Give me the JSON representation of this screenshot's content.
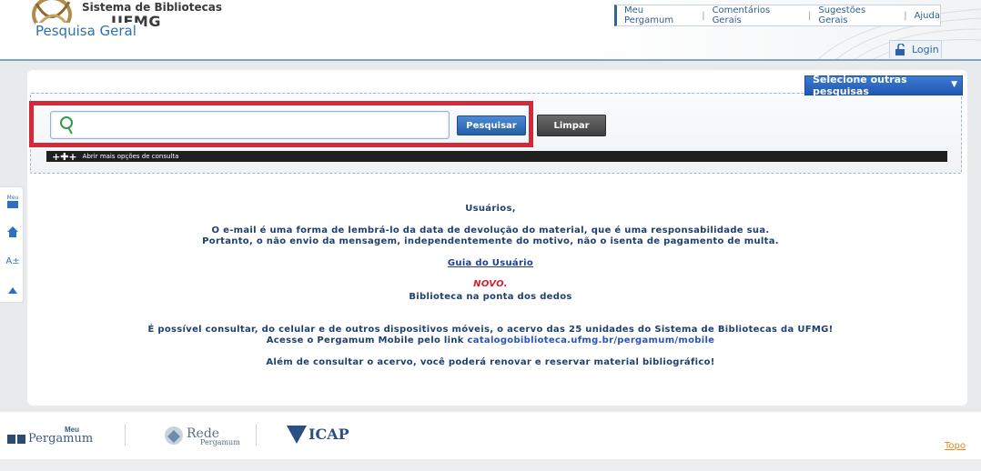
{
  "header": {
    "logo_title": "Sistema de Bibliotecas",
    "logo_subtitle": "UFMG",
    "nav": [
      {
        "label": "Meu Pergamum"
      },
      {
        "label": "Comentários Gerais"
      },
      {
        "label": "Sugestões Gerais"
      },
      {
        "label": "Ajuda"
      }
    ],
    "login_label": "Login"
  },
  "search": {
    "legend": "Pesquisa Geral",
    "select_others_label": "Selecione outras pesquisas",
    "input_value": "",
    "search_button": "Pesquisar",
    "clear_button": "Limpar",
    "more_options": "Abrir mais opções de consulta"
  },
  "side_tools": [
    {
      "icon": "meu-pergamum-icon",
      "label": "Meu"
    },
    {
      "icon": "home-icon"
    },
    {
      "icon": "font-size-icon",
      "label": "A±"
    },
    {
      "icon": "up-arrow-icon"
    }
  ],
  "message": {
    "greeting": "Usuários,",
    "line1": "O e-mail é uma forma de lembrá-lo da data de devolução do material, que é uma responsabilidade sua.",
    "line2": "Portanto, o não envio da mensagem, independentemente do motivo, não o isenta de pagamento de multa.",
    "guide_link": "Guia do Usuário",
    "novo": "NOVO.",
    "app_name": "Biblioteca na ponta dos dedos",
    "mobile_line1": "É possível consultar, do celular e de outros dispositivos móveis, o acervo das 25 unidades do Sistema de Bibliotecas da UFMG!",
    "mobile_line2_prefix": "Acesse o Pergamum Mobile pelo link ",
    "mobile_link": "catalogobiblioteca.ufmg.br/pergamum/mobile",
    "mobile_line3": "Além de consultar o acervo, você poderá renovar e reservar material bibliográfico!"
  },
  "footer": {
    "logo1_small": "Meu",
    "logo1": "Pergamum",
    "logo2": "Rede",
    "logo2_small": "Pergamum",
    "logo3": "ICAP",
    "top_link": "Topo"
  },
  "colors": {
    "accent": "#2f6fae",
    "highlight": "#d32a3a",
    "search_button": "#245ea6"
  }
}
